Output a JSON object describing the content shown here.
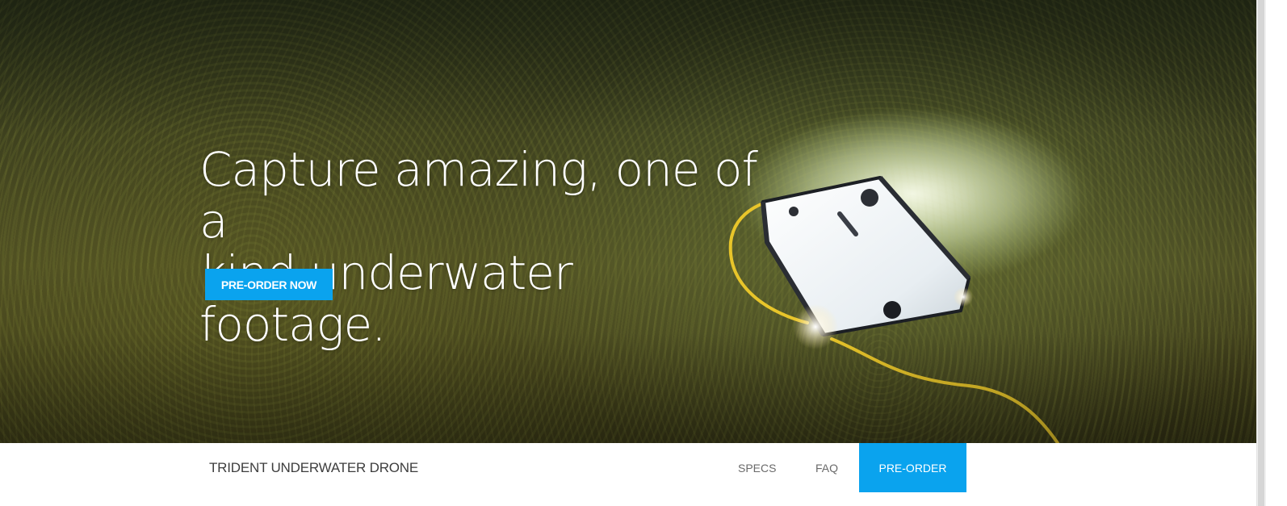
{
  "hero": {
    "headline": "Capture amazing, one of a\nkind underwater footage.",
    "cta_label": "PRE-ORDER NOW",
    "background_image": "underwater-drone-on-seagrass"
  },
  "navbar": {
    "brand": "TRIDENT UNDERWATER DRONE",
    "links": [
      {
        "label": "SPECS"
      },
      {
        "label": "FAQ"
      }
    ],
    "preorder_label": "PRE-ORDER"
  },
  "colors": {
    "accent": "#0aa3ee",
    "nav_text": "#6a6a6a",
    "brand_text": "#3d3d3d"
  }
}
